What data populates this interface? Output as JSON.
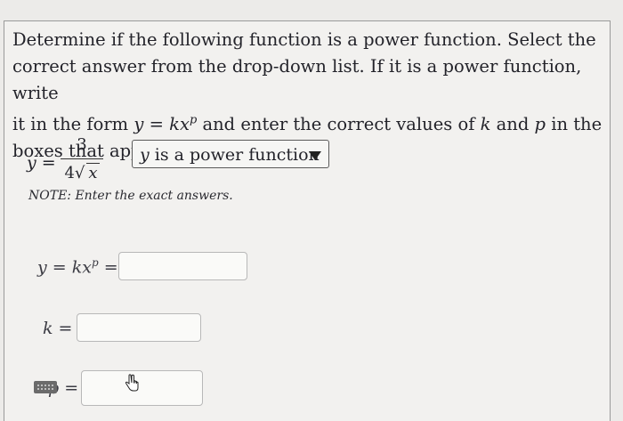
{
  "question": {
    "line1": "Determine if the following function is a power function.  Select the",
    "line2": "correct answer from the drop-down list.  If it is a power function, write",
    "line3_pre": "it in the form ",
    "line3_form": "y = kx",
    "line3_exp": "p",
    "line3_mid": " and enter the correct values of ",
    "line3_k": "k",
    "line3_and": " and ",
    "line3_p": "p",
    "line3_post": " in the",
    "line4": "boxes that appear."
  },
  "function": {
    "lhs": "y =",
    "numerator": "3",
    "denominator_coef": "4",
    "denominator_radical": "√",
    "denominator_var": "x"
  },
  "dropdown": {
    "selected_var": "y",
    "selected_text": " is a power function"
  },
  "note": "NOTE: Enter the exact answers.",
  "fields": {
    "form_label": "y = kx",
    "form_exp": "p",
    "form_eq": " =",
    "form_value": "",
    "k_label": "k =",
    "k_value": "",
    "p_label": "p =",
    "p_value": ""
  }
}
